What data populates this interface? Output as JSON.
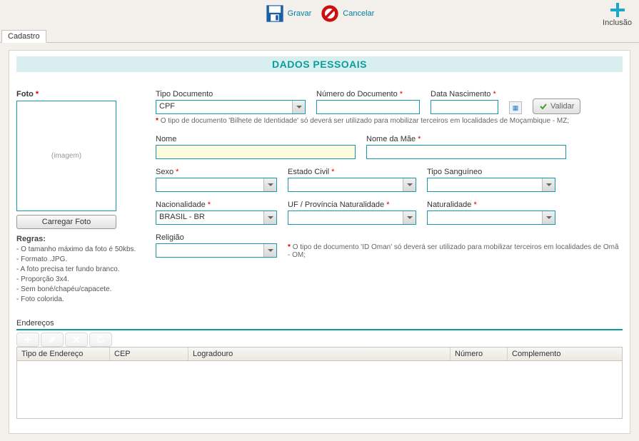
{
  "toolbar": {
    "save_label": "Gravar",
    "cancel_label": "Cancelar",
    "add_label": "Inclusão"
  },
  "tab": {
    "label": "Cadastro"
  },
  "section_title": "DADOS PESSOAIS",
  "photo": {
    "label": "Foto",
    "placeholder": "(imagem)",
    "upload_label": "Carregar Foto",
    "rules_title": "Regras:",
    "rules": [
      "- O tamanho máximo da foto é 50kbs.",
      "- Formato .JPG.",
      "- A foto precisa ter fundo branco.",
      "- Proporção 3x4.",
      "- Sem boné/chapéu/capacete.",
      "- Foto colorida."
    ]
  },
  "fields": {
    "tipo_documento_label": "Tipo Documento",
    "tipo_documento_value": "CPF",
    "numero_documento_label": "Número do Documento",
    "data_nascimento_label": "Data Nascimento",
    "validar_label": "Validar",
    "doc_note": "O tipo de documento 'Bilhete de Identidade' só deverá ser utilizado para mobilizar terceiros em localidades de Moçambique - MZ;",
    "nome_label": "Nome",
    "nome_mae_label": "Nome da Mãe",
    "sexo_label": "Sexo",
    "estado_civil_label": "Estado Civil",
    "tipo_sanguineo_label": "Tipo Sanguíneo",
    "nacionalidade_label": "Nacionalidade",
    "nacionalidade_value": "BRASIL - BR",
    "uf_naturalidade_label": "UF / Província Naturalidade",
    "naturalidade_label": "Naturalidade",
    "religiao_label": "Religião",
    "religiao_note": "O tipo de documento 'ID Oman' só deverá ser utilizado para mobilizar terceiros em localidades de Omã - OM;"
  },
  "addresses": {
    "title": "Endereços",
    "columns": {
      "tipo": "Tipo de Endereço",
      "cep": "CEP",
      "logradouro": "Logradouro",
      "numero": "Número",
      "complemento": "Complemento"
    }
  }
}
